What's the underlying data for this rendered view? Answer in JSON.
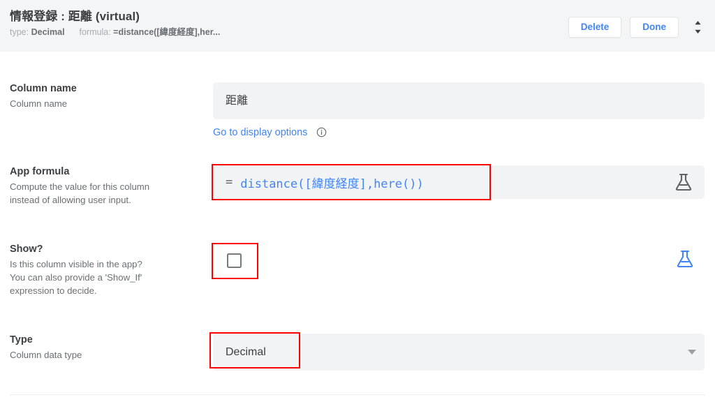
{
  "header": {
    "title": "情報登録 : 距離 (virtual)",
    "type_label": "type:",
    "type_value": "Decimal",
    "formula_label": "formula:",
    "formula_value": "=distance([緯度経度],her...",
    "delete_label": "Delete",
    "done_label": "Done",
    "expander_icon": "chevron-up-down-icon"
  },
  "rows": {
    "column_name": {
      "title": "Column name",
      "desc": "Column name",
      "value": "距離",
      "link_label": "Go to display options",
      "info_icon": "info-circle-icon"
    },
    "app_formula": {
      "title": "App formula",
      "desc_line1": "Compute the value for this column",
      "desc_line2": "instead of allowing user input.",
      "equals": "=",
      "formula": "distance([緯度経度],here())",
      "formula_color": "#4285f4",
      "flask_icon": "flask-icon",
      "flask_color": "#5f6368"
    },
    "show": {
      "title": "Show?",
      "desc_line1": "Is this column visible in the app?",
      "desc_line2": "You can also provide a 'Show_If'",
      "desc_line3": "expression to decide.",
      "checked": "false",
      "flask_icon": "flask-icon",
      "flask_color": "#4285f4"
    },
    "type": {
      "title": "Type",
      "desc": "Column data type",
      "value": "Decimal",
      "caret_icon": "dropdown-caret-icon"
    }
  },
  "highlight_color": "#ff0000"
}
